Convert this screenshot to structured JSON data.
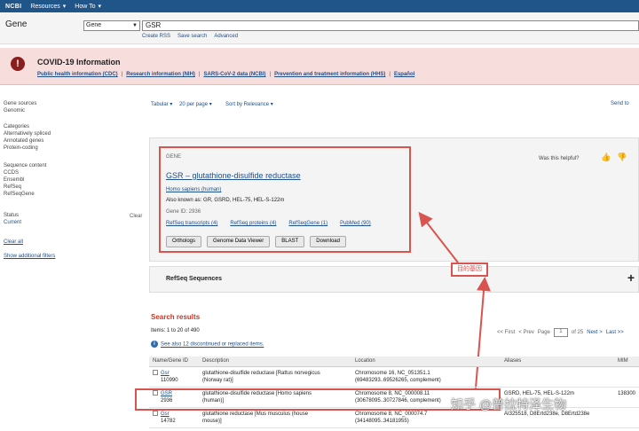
{
  "topbar": {
    "logo": "NCBI",
    "links": [
      "Resources",
      "How To"
    ],
    "chevron": "chevron-down-icon"
  },
  "search": {
    "db_title": "Gene",
    "db_selected": "Gene",
    "query": "GSR",
    "links": [
      "Create RSS",
      "Save search",
      "Advanced"
    ]
  },
  "covid": {
    "title": "COVID-19 Information",
    "links": [
      "Public health information (CDC)",
      "Research information (NIH)",
      "SARS-CoV-2 data (NCBI)",
      "Prevention and treatment information (HHS)",
      "Español"
    ]
  },
  "sidebar": {
    "groups": [
      [
        "Gene sources",
        "Genomic"
      ],
      [
        "Categories",
        "Alternatively spliced",
        "Annotated genes",
        "Protein-coding"
      ],
      [
        "Sequence content",
        "CCDS",
        "Ensembl",
        "RefSeq",
        "RefSeqGene"
      ],
      [
        "Status",
        "Current"
      ]
    ],
    "clear": "Clear",
    "clear_all": "Clear all",
    "show_filters": "Show additional filters"
  },
  "toolbar": {
    "format": "Tabular",
    "per_page": "20 per page",
    "sort": "Sort by Relevance",
    "send": "Send to"
  },
  "gene_card": {
    "label": "GENE",
    "heading": "GSR – glutathione-disulfide reductase",
    "organism": "Homo sapiens (human)",
    "aliases": "Also known as: GR, GSRD, HEL-75, HEL-S-122m",
    "gene_id": "Gene ID: 2936",
    "resources": [
      "RefSeq transcripts (4)",
      "RefSeq proteins (4)",
      "RefSeqGene (1)",
      "PubMed (90)"
    ],
    "buttons": [
      "Orthologs",
      "Genome Data Viewer",
      "BLAST",
      "Download"
    ],
    "helpful": "Was this helpful?"
  },
  "refseq": {
    "title": "RefSeq Sequences"
  },
  "annotation": {
    "label": "目的基因",
    "color": "#d9534f"
  },
  "results": {
    "title": "Search results",
    "items": "Items: 1 to 20 of 490",
    "see_also": "See also 12 discontinued or replaced items.",
    "pager": {
      "first": "<< First",
      "prev": "< Prev",
      "page_label": "Page",
      "page": "1",
      "of": "of 25",
      "next": "Next >",
      "last": "Last >>"
    },
    "columns": [
      "Name/Gene ID",
      "Description",
      "Location",
      "Aliases",
      "MIM"
    ],
    "rows": [
      {
        "name": "Gsr",
        "id": "110990",
        "desc1": "glutathione-disulfide reductase [Rattus norvegicus",
        "desc2": "(Norway rat)]",
        "loc1": "Chromosome 16, NC_051351.1",
        "loc2": "(69483293..69526265, complement)",
        "aliases": "",
        "mim": ""
      },
      {
        "name": "GSR",
        "id": "2936",
        "desc1": "glutathione-disulfide reductase [Homo sapiens",
        "desc2": "(human)]",
        "loc1": "Chromosome 8, NC_000008.11",
        "loc2": "(30678095..30727846, complement)",
        "aliases": "GSRD, HEL-75, HEL-S-122m",
        "mim": "138300"
      },
      {
        "name": "Gsr",
        "id": "14782",
        "desc1": "glutathione reductase [Mus musculus (house",
        "desc2": "mouse)]",
        "loc1": "Chromosome 8, NC_000074.7",
        "loc2": "(34148095..34181955)",
        "aliases": "AI325518, D8Ertd238e, D8Ertd238e",
        "mim": ""
      }
    ]
  },
  "watermark": "知乎 @普拉特泽生物"
}
